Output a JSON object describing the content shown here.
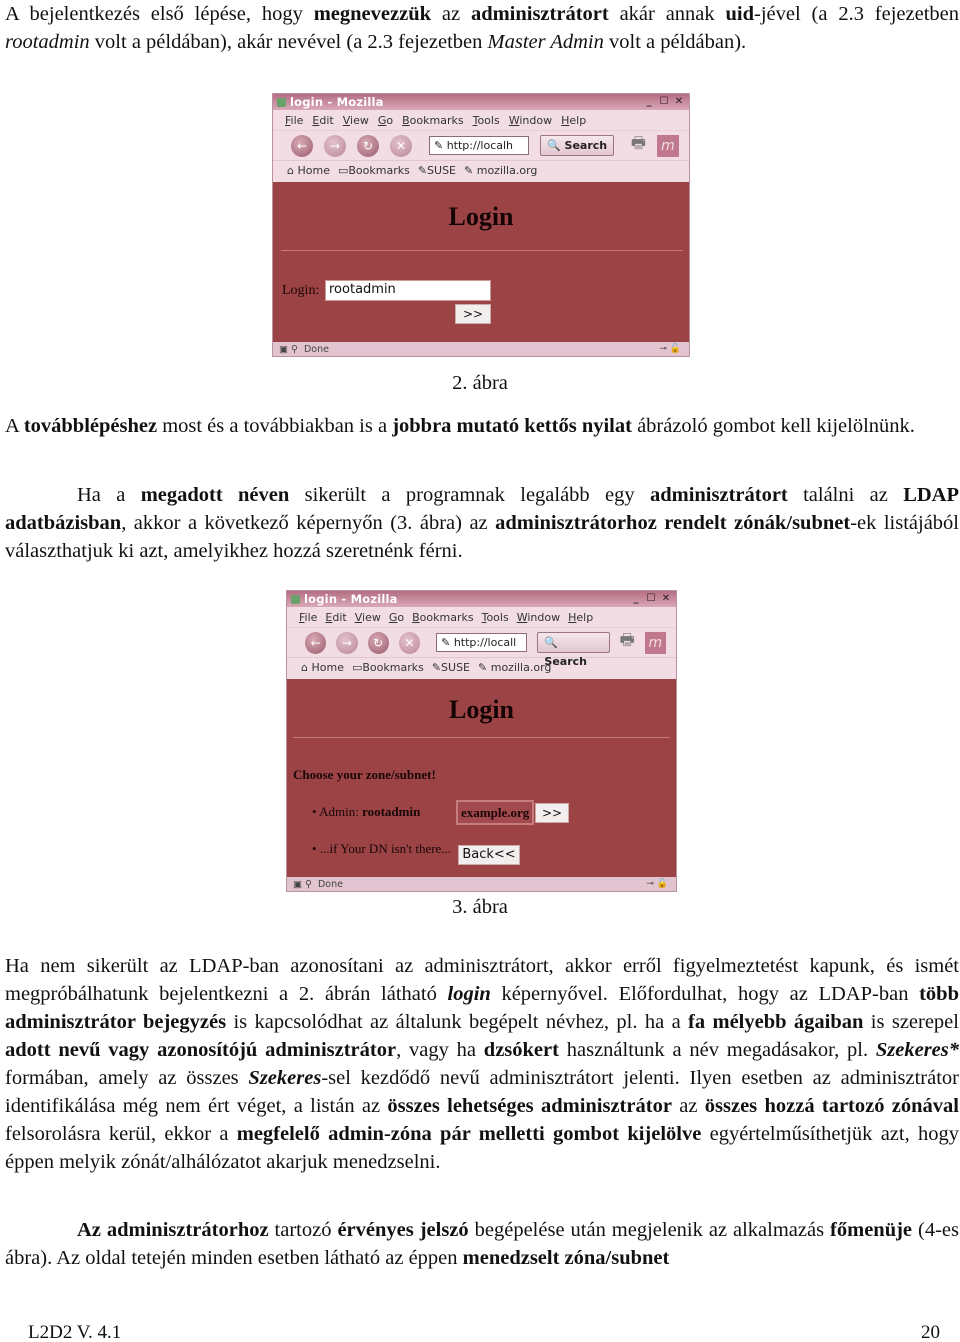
{
  "doc": {
    "para1": [
      {
        "t": "A bejelentkezés első lépése, hogy "
      },
      {
        "t": "megnevezzük",
        "b": true
      },
      {
        "t": " az "
      },
      {
        "t": "adminisztrátort",
        "b": true
      },
      {
        "t": " akár annak "
      },
      {
        "t": "uid",
        "b": true
      },
      {
        "t": "-jével (a 2.3 fejezetben "
      },
      {
        "t": "rootadmin",
        "i": true
      },
      {
        "t": " volt a példában), akár nevével (a 2.3 fejezetben "
      },
      {
        "t": "Master Admin",
        "i": true
      },
      {
        "t": " volt a példában)."
      }
    ],
    "caption2": "2. ábra",
    "para2": [
      {
        "t": "A "
      },
      {
        "t": "továbblépéshez",
        "b": true
      },
      {
        "t": " most és a továbbiakban is a "
      },
      {
        "t": "jobbra mutató kettős nyilat",
        "b": true
      },
      {
        "t": " ábrázoló gombot kell kijelölnünk."
      }
    ],
    "para3": [
      {
        "t": "Ha a "
      },
      {
        "t": "megadott néven",
        "b": true
      },
      {
        "t": " sikerült a programnak legalább egy "
      },
      {
        "t": "adminisztrátort",
        "b": true
      },
      {
        "t": " találni az "
      },
      {
        "t": "LDAP adatbázisban",
        "b": true
      },
      {
        "t": ", akkor a következő képernyőn (3. ábra) az "
      },
      {
        "t": "adminisztrátorhoz rendelt zónák/subnet",
        "b": true
      },
      {
        "t": "-ek listájából választhatjuk ki azt, amelyikhez hozzá szeretnénk férni."
      }
    ],
    "caption3": "3. ábra",
    "para4": [
      {
        "t": "Ha nem sikerült az LDAP-ban azonosítani az adminisztrátort, akkor erről figyelmeztetést kapunk, és ismét megpróbálhatunk bejelentkezni a 2. ábrán látható "
      },
      {
        "t": "login",
        "b": true,
        "i": true
      },
      {
        "t": " képernyővel.  Előfordulhat, hogy az LDAP-ban "
      },
      {
        "t": "több adminisztrátor bejegyzés",
        "b": true
      },
      {
        "t": " is kapcsolódhat az általunk begépelt névhez, pl. ha a "
      },
      {
        "t": "fa mélyebb ágaiban",
        "b": true
      },
      {
        "t": " is szerepel "
      },
      {
        "t": "adott nevű vagy azonosítójú adminisztrátor",
        "b": true
      },
      {
        "t": ", vagy ha "
      },
      {
        "t": "dzsókert",
        "b": true
      },
      {
        "t": " használtunk a név megadásakor, pl. "
      },
      {
        "t": "Szekeres*",
        "b": true,
        "i": true
      },
      {
        "t": " formában, amely az összes "
      },
      {
        "t": "Szekeres",
        "b": true,
        "i": true
      },
      {
        "t": "-sel kezdődő nevű adminisztrátort jelenti.  Ilyen esetben az adminisztrátor identifikálása még nem ért véget, a listán az "
      },
      {
        "t": "összes lehetséges adminisztrátor",
        "b": true
      },
      {
        "t": " az "
      },
      {
        "t": "összes hozzá tartozó zónával",
        "b": true
      },
      {
        "t": " felsorolásra kerül, ekkor a "
      },
      {
        "t": "megfelelő admin-zóna pár melletti gombot kijelölve",
        "b": true
      },
      {
        "t": " egyértelműsíthetjük azt, hogy éppen melyik zónát/alhálózatot akarjuk menedzselni."
      }
    ],
    "para5": [
      {
        "t": "Az adminisztrátorhoz",
        "b": true
      },
      {
        "t": " tartozó "
      },
      {
        "t": "érvényes jelszó",
        "b": true
      },
      {
        "t": " begépelése után megjelenik az alkalmazás "
      },
      {
        "t": "főmenüje",
        "b": true
      },
      {
        "t": " (4-es ábra). Az oldal tetején minden esetben látható az éppen "
      },
      {
        "t": "menedzselt zóna/subnet",
        "b": true
      }
    ],
    "footer_left": "L2D2 V. 4.1",
    "footer_right": "20"
  },
  "browser": {
    "title": "login - Mozilla",
    "window_buttons": [
      "_",
      "☐",
      "✕"
    ],
    "menu": [
      "File",
      "Edit",
      "View",
      "Go",
      "Bookmarks",
      "Tools",
      "Window",
      "Help"
    ],
    "nav_glyphs": {
      "back": "←",
      "forward": "→",
      "reload": "↻",
      "stop": "✕"
    },
    "url_fig2": "✎ http://localh",
    "url_fig3": "✎ http://locall",
    "search_label": "🔍 Search",
    "print_glyph": "🖶",
    "logo_glyph": "m",
    "bookmarks": [
      "⌂ Home",
      "▭Bookmarks",
      "✎SUSE",
      "✎ mozilla.org"
    ],
    "status": "Done",
    "status_right": "⊸ 🔓",
    "colors": {
      "content_bg": "#9c4346",
      "chrome_bg": "#f1dde3",
      "titlebar": "#b46d82"
    }
  },
  "fig2": {
    "heading": "Login",
    "login_label": "Login:",
    "login_value": "rootadmin",
    "submit_label": ">>"
  },
  "fig3": {
    "heading": "Login",
    "zone_title": "Choose your zone/subnet!",
    "items": [
      {
        "prefix": "• Admin: ",
        "name": "rootadmin"
      },
      {
        "prefix": "• ...if Your DN isn't there...",
        "name": ""
      }
    ],
    "zone_value": "example.org",
    "submit_label": ">>",
    "back_label": "Back<<"
  }
}
